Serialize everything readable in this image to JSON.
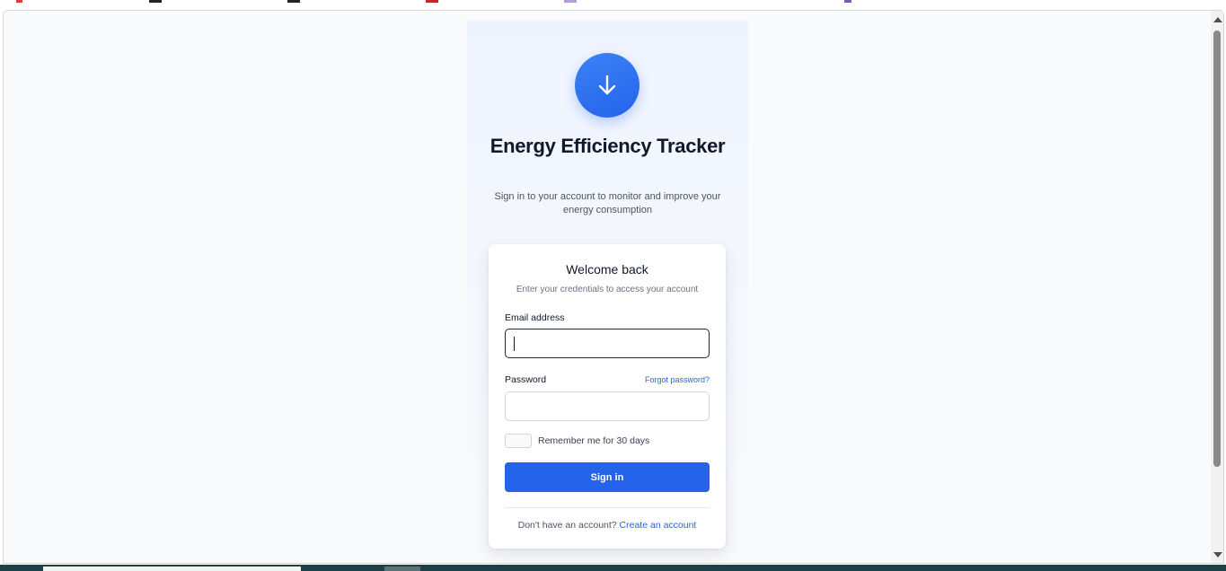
{
  "app": {
    "title": "Energy Efficiency Tracker",
    "subtitle": "Sign in to your account to monitor and improve your energy consumption",
    "logo_icon": "arrow-down-icon"
  },
  "card": {
    "title": "Welcome back",
    "subtitle": "Enter your credentials to access your account",
    "email_label": "Email address",
    "email_value": "",
    "password_label": "Password",
    "forgot_label": "Forgot password?",
    "password_value": "",
    "remember_label": "Remember me for 30 days",
    "remember_checked": false,
    "signin_label": "Sign in",
    "footer_prompt": "Don't have an account?",
    "footer_link": "Create an account"
  },
  "colors": {
    "accent": "#2563eb",
    "background": "#f8fafc",
    "text": "#111827"
  }
}
